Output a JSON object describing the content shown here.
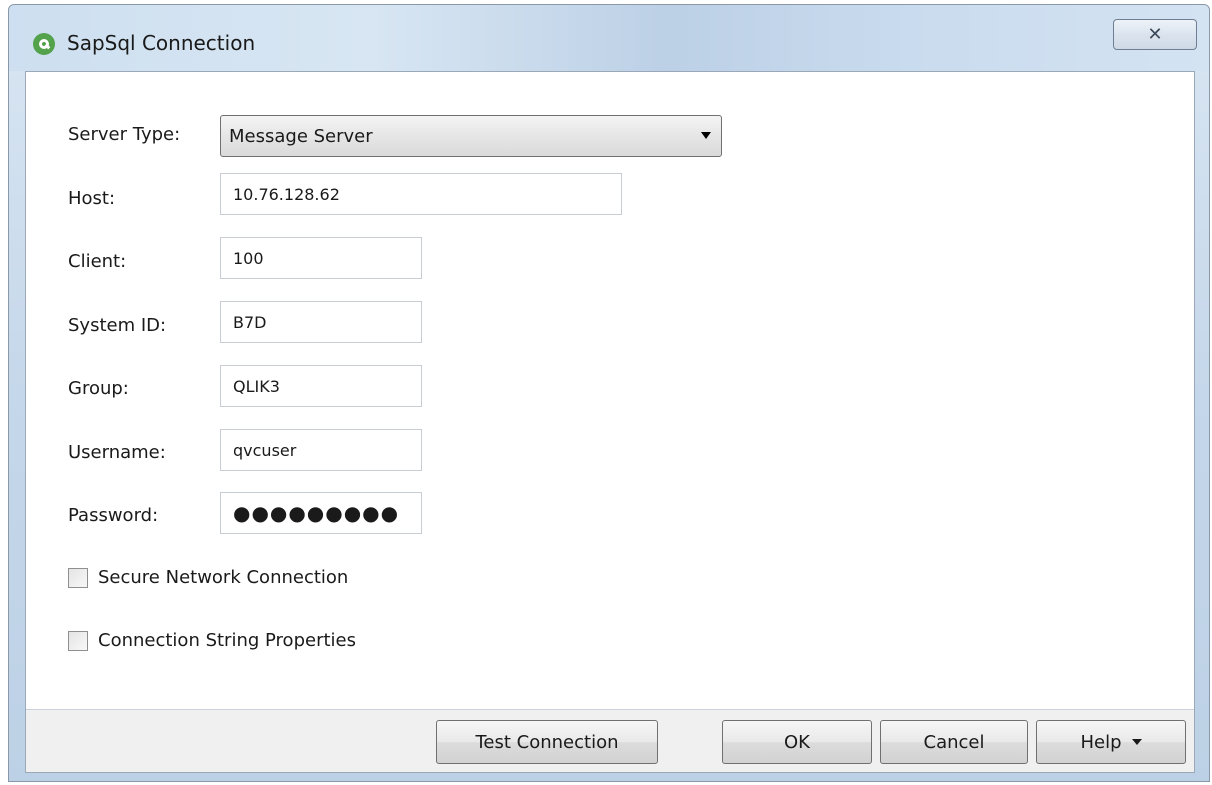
{
  "window": {
    "title": "SapSql Connection",
    "close_symbol": "✕"
  },
  "form": {
    "server_type": {
      "label": "Server Type:",
      "value": "Message Server"
    },
    "host": {
      "label": "Host:",
      "value": "10.76.128.62"
    },
    "client": {
      "label": "Client:",
      "value": "100"
    },
    "system_id": {
      "label": "System ID:",
      "value": "B7D"
    },
    "group": {
      "label": "Group:",
      "value": "QLIK3"
    },
    "username": {
      "label": "Username:",
      "value": "qvcuser"
    },
    "password": {
      "label": "Password:",
      "value": "●●●●●●●●●"
    },
    "secure_network": {
      "label": "Secure Network Connection",
      "checked": false
    },
    "connection_string": {
      "label": "Connection String Properties",
      "checked": false
    }
  },
  "buttons": {
    "test_connection": "Test Connection",
    "ok": "OK",
    "cancel": "Cancel",
    "help": "Help"
  },
  "icons": {
    "app": "qlik-app-icon",
    "close": "close-icon",
    "dropdown": "chevron-down-icon"
  }
}
